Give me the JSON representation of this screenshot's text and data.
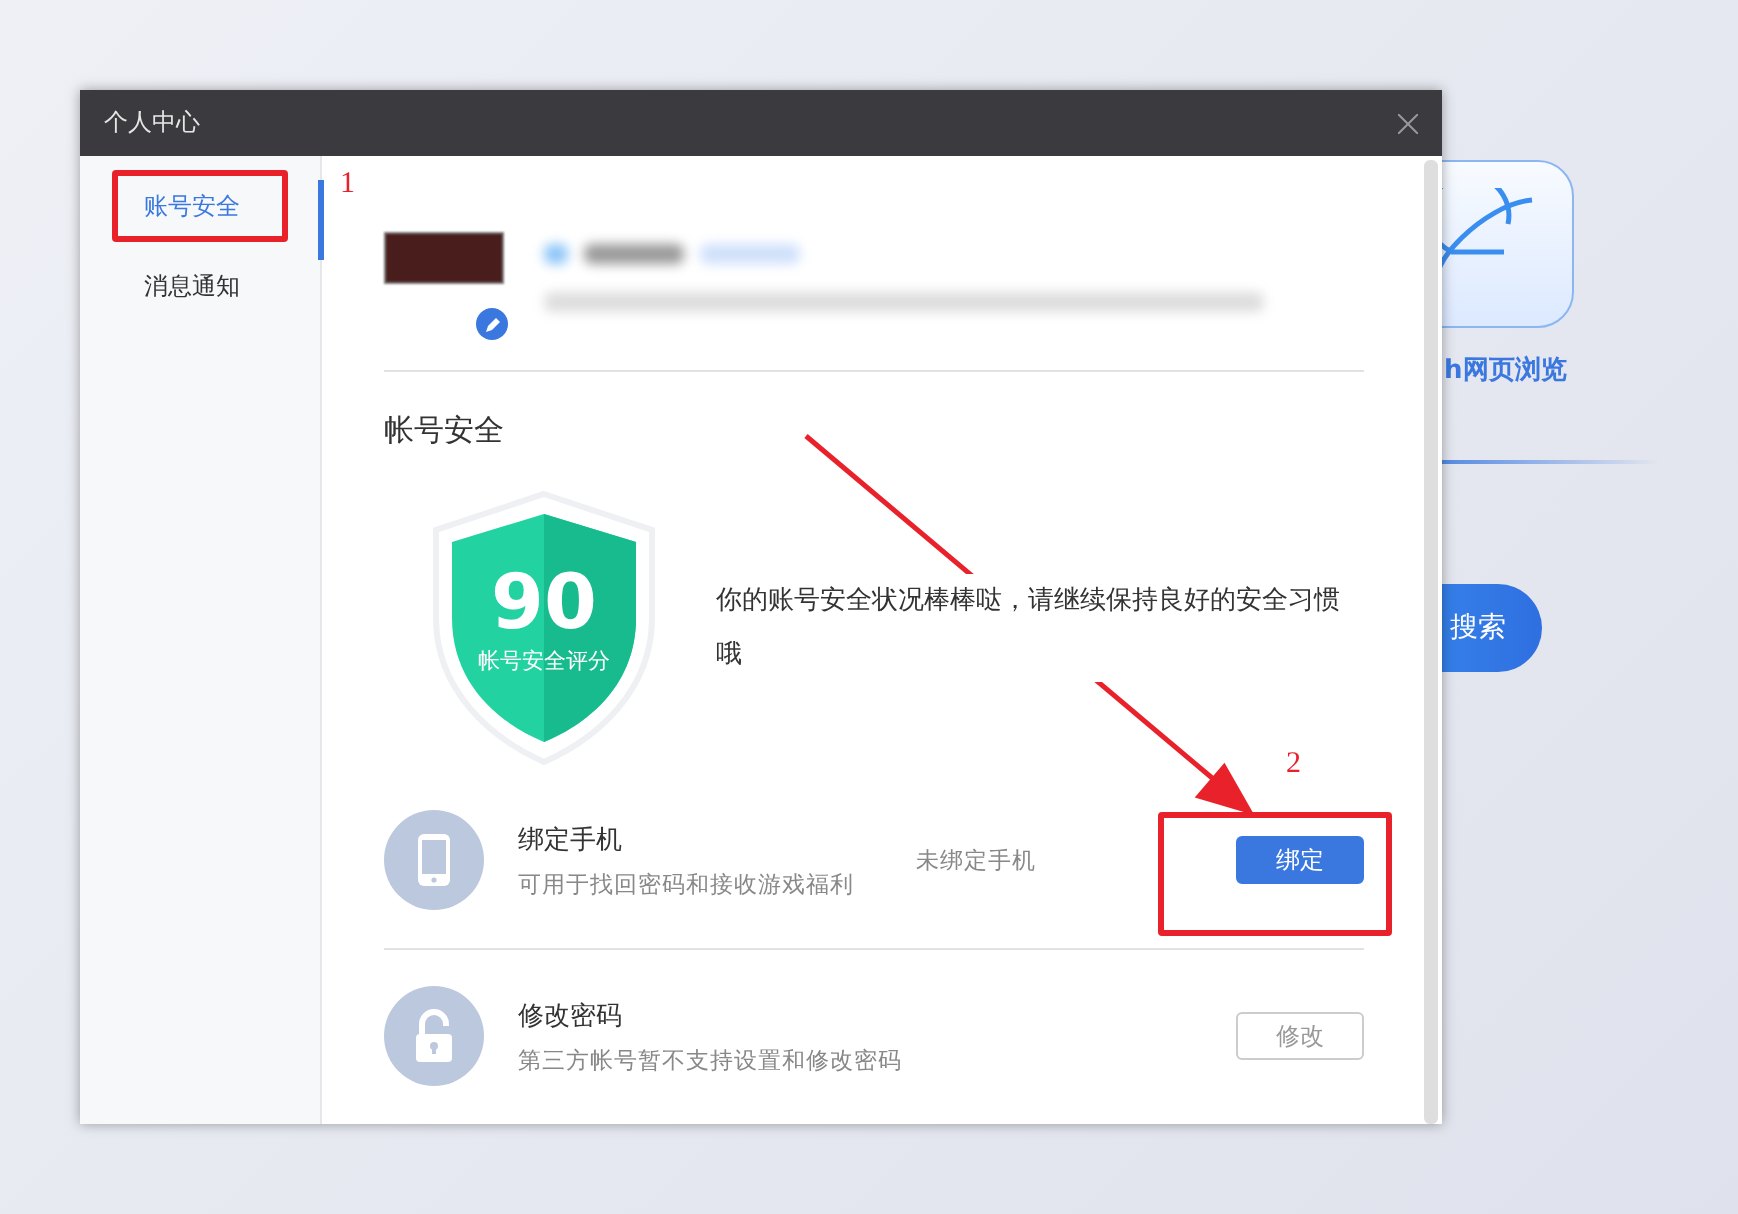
{
  "background_app": {
    "tile_label": "h网页浏览",
    "search_button": "搜索"
  },
  "window": {
    "title": "个人中心"
  },
  "sidebar": {
    "items": [
      {
        "label": "账号安全",
        "selected": true
      },
      {
        "label": "消息通知",
        "selected": false
      }
    ]
  },
  "section_title": "帐号安全",
  "score": {
    "value": "90",
    "label": "帐号安全评分",
    "message": "你的账号安全状况棒棒哒，请继续保持良好的安全习惯哦"
  },
  "security_items": [
    {
      "kind": "phone",
      "title": "绑定手机",
      "description": "可用于找回密码和接收游戏福利",
      "status": "未绑定手机",
      "action": "绑定",
      "disabled": false
    },
    {
      "kind": "password",
      "title": "修改密码",
      "description": "第三方帐号暂不支持设置和修改密码",
      "action": "修改",
      "disabled": true
    }
  ],
  "annotations": [
    {
      "label": "1"
    },
    {
      "label": "2"
    }
  ]
}
